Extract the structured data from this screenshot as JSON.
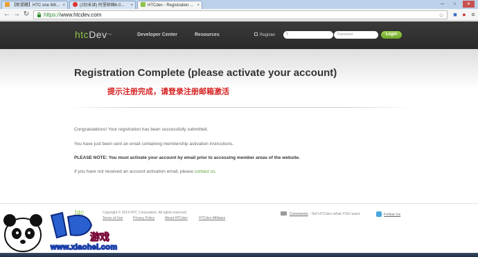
{
  "browser": {
    "tabs": [
      {
        "label": "【新提醒】HTC one M8..."
      },
      {
        "label": "(2封未读) 阿里邮箱6.0..."
      },
      {
        "label": "HTCdev - Registration ..."
      }
    ],
    "url_scheme": "https://",
    "url_host": "www.htcdev.com"
  },
  "header": {
    "logo_htc": "htc",
    "logo_dev": "Dev",
    "logo_tm": "TM",
    "nav": [
      "Developer Center",
      "Resources"
    ],
    "register": "Register",
    "login_username": "\\",
    "login_password_placeholder": "Password",
    "login_button": "Login"
  },
  "main": {
    "title": "Registration Complete (please activate your account)",
    "annotation": "提示注册完成，请登录注册邮箱激活",
    "para1": "Congratulations! Your registration has been successfully submitted.",
    "para2": "You have just been sent an email containing membership activation instructions.",
    "note_label": "PLEASE NOTE:",
    "note_text": " You must activate your account by email prior to accessing member areas of the website.",
    "para4_prefix": "If you have not received an account activation email, please ",
    "para4_link": "contact us",
    "para4_suffix": "."
  },
  "footer": {
    "logo": "htc",
    "copyright": "Copyright © 2014 HTC Corporation. All rights reserved.",
    "links": [
      "Terms of Use",
      "Privacy Policy",
      "About HTCdev",
      "HTCdev Affiliates"
    ],
    "comments_link": "Comments",
    "comments_text": " - Tell HTCdev what YOU want.",
    "follow": "Follow Us"
  },
  "watermark": {
    "site": "www.xiaohei.com",
    "brand": "游戏"
  },
  "colors": {
    "accent_green": "#8ec24a",
    "annotation_red": "#d42020",
    "header_dark": "#2f2f2f"
  }
}
